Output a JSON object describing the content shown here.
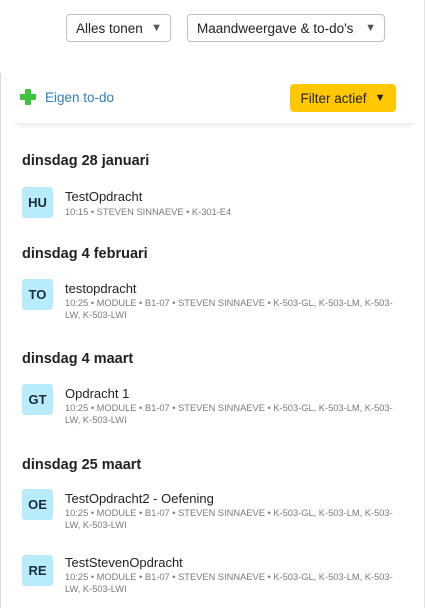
{
  "filters": {
    "show_select": "Alles tonen",
    "view_select": "Maandweergave & to-do's"
  },
  "actions": {
    "add_todo_label": "Eigen to-do",
    "filter_label": "Filter actief"
  },
  "days": [
    {
      "header": "dinsdag 28 januari",
      "items": [
        {
          "badge": "HU",
          "title": "TestOpdracht",
          "meta": "10:15 • STEVEN SINNAEVE • K-301-E4"
        }
      ]
    },
    {
      "header": "dinsdag 4 februari",
      "items": [
        {
          "badge": "TO",
          "title": "testopdracht",
          "meta": "10:25 • MODULE • B1-07 • STEVEN SINNAEVE • K-503-GL, K-503-LM, K-503-LW, K-503-LWI"
        }
      ]
    },
    {
      "header": "dinsdag 4 maart",
      "items": [
        {
          "badge": "GT",
          "title": "Opdracht 1",
          "meta": "10:25 • MODULE • B1-07 • STEVEN SINNAEVE • K-503-GL, K-503-LM, K-503-LW, K-503-LWI"
        }
      ]
    },
    {
      "header": "dinsdag 25 maart",
      "items": [
        {
          "badge": "OE",
          "title": "TestOpdracht2 - Oefening",
          "meta": "10:25 • MODULE • B1-07 • STEVEN SINNAEVE • K-503-GL, K-503-LM, K-503-LW, K-503-LWI"
        },
        {
          "badge": "RE",
          "title": "TestStevenOpdracht",
          "meta": "10:25 • MODULE • B1-07 • STEVEN SINNAEVE • K-503-GL, K-503-LM, K-503-LW, K-503-LWI"
        }
      ]
    }
  ],
  "colors": {
    "accent_yellow": "#ffc800",
    "link_blue": "#2d7fc1",
    "plus_green": "#3ec43e",
    "badge_bg": "#b9ecfb"
  }
}
